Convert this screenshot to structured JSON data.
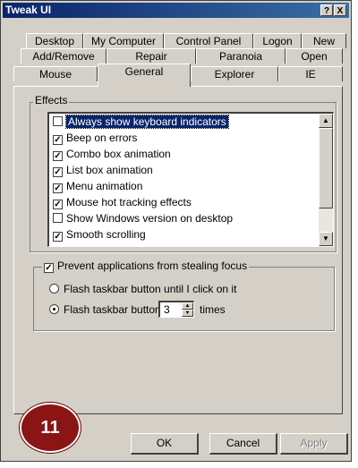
{
  "window": {
    "title": "Tweak UI",
    "help_glyph": "?",
    "close_glyph": "X"
  },
  "tabs": {
    "row1": [
      "Desktop",
      "My Computer",
      "Control Panel",
      "Logon",
      "New"
    ],
    "row2": [
      "Add/Remove",
      "Repair",
      "Paranoia",
      "Open"
    ],
    "row3": [
      "Mouse",
      "General",
      "Explorer",
      "IE"
    ],
    "active": "General"
  },
  "effects": {
    "label": "Effects",
    "items": [
      {
        "label": "Always show keyboard indicators",
        "checked": false,
        "selected": true
      },
      {
        "label": "Beep on errors",
        "checked": true
      },
      {
        "label": "Combo box animation",
        "checked": true
      },
      {
        "label": "List box animation",
        "checked": true
      },
      {
        "label": "Menu animation",
        "checked": true
      },
      {
        "label": "Mouse hot tracking effects",
        "checked": true
      },
      {
        "label": "Show Windows version on desktop",
        "checked": false
      },
      {
        "label": "Smooth scrolling",
        "checked": true
      }
    ]
  },
  "focus": {
    "label": "Prevent applications from stealing focus",
    "checked": true,
    "option1": "Flash taskbar button until I click on it",
    "option2_prefix": "Flash taskbar button",
    "option2_value": "3",
    "option2_suffix": "times",
    "selected_option": 2
  },
  "buttons": {
    "ok": "OK",
    "cancel": "Cancel",
    "apply": "Apply"
  },
  "badge": {
    "number": "11",
    "color": "#8b1414"
  }
}
